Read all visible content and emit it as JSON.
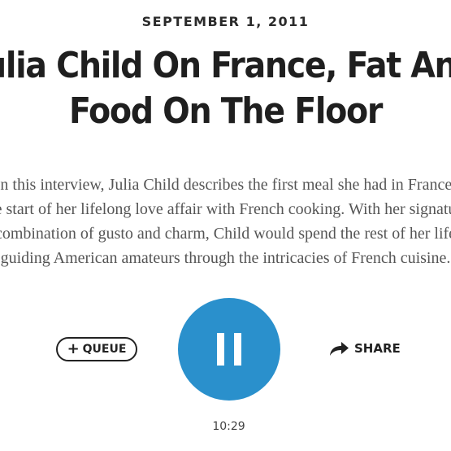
{
  "story": {
    "date": "SEPTEMBER 1, 2011",
    "title_lines": [
      "Julia Child On France, Fat And",
      "Food On The Floor"
    ],
    "description_lines": [
      "In this interview, Julia Child describes the first meal she had in France,",
      "the start of her lifelong love affair with French cooking. With her signature",
      "combination of gusto and charm, Child would spend the rest of her life",
      "guiding American amateurs through the intricacies of French cuisine."
    ]
  },
  "player": {
    "queue_label": "QUEUE",
    "queue_icon": "plus-icon",
    "play_state": "playing",
    "pause_icon": "pause-icon",
    "share_label": "SHARE",
    "share_icon": "share-arrow-icon",
    "duration": "10:29",
    "accent_color": "#2a90cc"
  }
}
